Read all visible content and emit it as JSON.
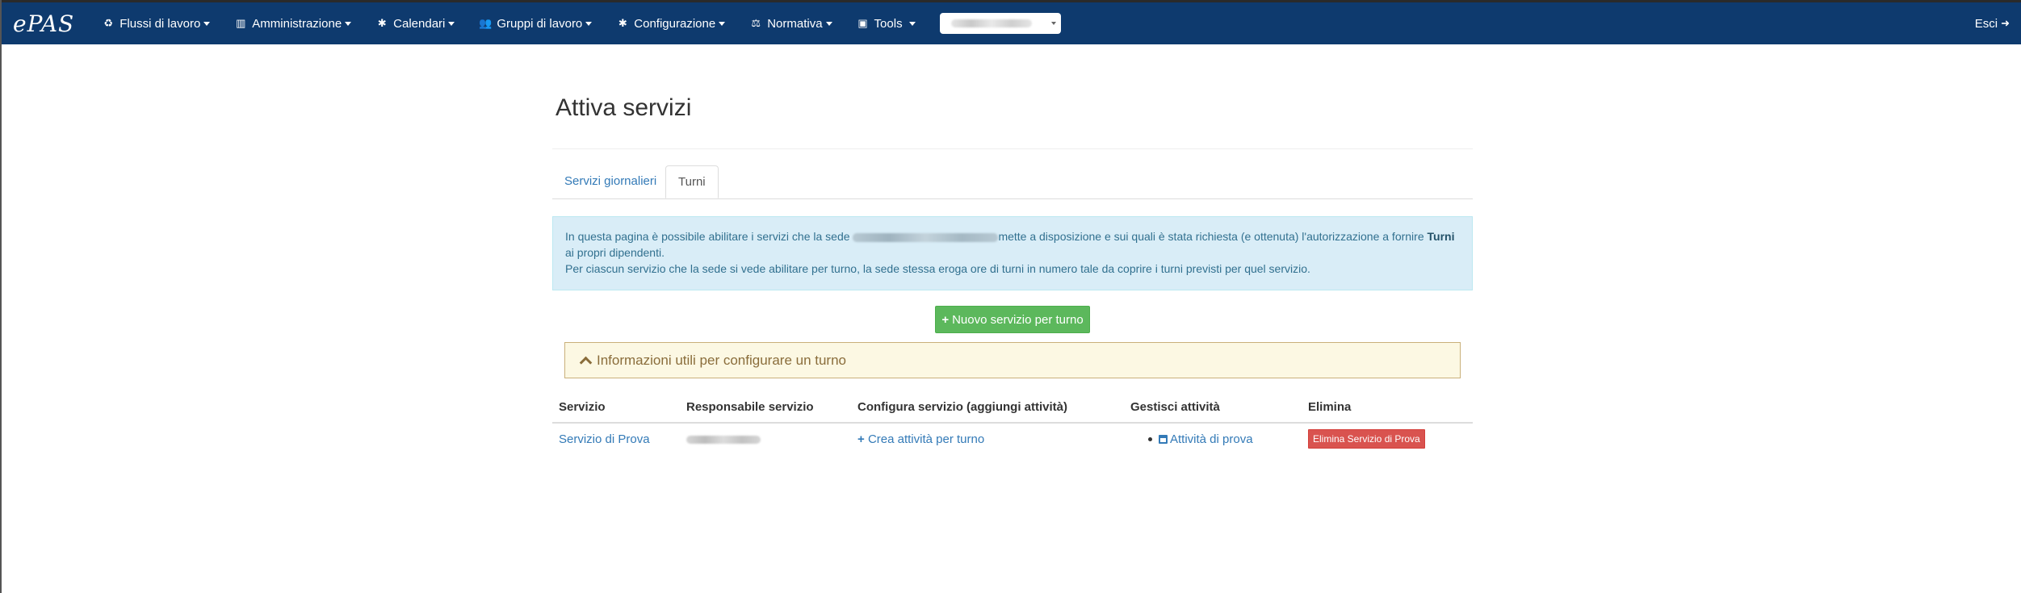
{
  "navbar": {
    "brand": "ePAS",
    "items": [
      {
        "label": "Flussi di lavoro",
        "icon": "recycle-icon",
        "glyph": "♻"
      },
      {
        "label": "Amministrazione",
        "icon": "bar-chart-icon",
        "glyph": "▥"
      },
      {
        "label": "Calendari",
        "icon": "gear-icon",
        "glyph": "✱"
      },
      {
        "label": "Gruppi di lavoro",
        "icon": "users-icon",
        "glyph": "👥"
      },
      {
        "label": "Configurazione",
        "icon": "gear-icon",
        "glyph": "✱"
      },
      {
        "label": "Normativa",
        "icon": "balance-scale-icon",
        "glyph": "⚖"
      },
      {
        "label": "Tools",
        "icon": "briefcase-icon",
        "glyph": "▣"
      }
    ],
    "logout_label": "Esci",
    "logout_glyph": "➜"
  },
  "page": {
    "title": "Attiva servizi",
    "tabs": [
      {
        "label": "Servizi giornalieri",
        "active": false
      },
      {
        "label": "Turni",
        "active": true
      }
    ]
  },
  "alert": {
    "text_before": "In questa pagina è possibile abilitare i servizi che la sede ",
    "text_after": "mette a disposizione e sui quali è stata richiesta (e ottenuta) l'autorizzazione a fornire ",
    "bold_word": "Turni",
    "line2": "ai propri dipendenti.",
    "line3": "Per ciascun servizio che la sede si vede abilitare per turno, la sede stessa eroga ore di turni in numero tale da coprire i turni previsti per quel servizio."
  },
  "new_service_button": {
    "icon": "+",
    "label": "Nuovo servizio per turno"
  },
  "info_panel": {
    "label": "Informazioni utili per configurare un turno"
  },
  "table": {
    "headers": [
      "Servizio",
      "Responsabile servizio",
      "Configura servizio (aggiungi attività)",
      "Gestisci attività",
      "Elimina"
    ],
    "rows": [
      {
        "service": "Servizio di Prova",
        "configure_icon": "+",
        "configure_link": "Crea attività per turno",
        "activity": "Attività di prova",
        "delete_label": "Elimina Servizio di Prova"
      }
    ]
  },
  "colors": {
    "navbar": "#0e3a6e",
    "link": "#337ab7",
    "success": "#5cb85c",
    "danger": "#d9534f",
    "info_bg": "#d9edf7",
    "warning_bg": "#fcf8e3"
  }
}
